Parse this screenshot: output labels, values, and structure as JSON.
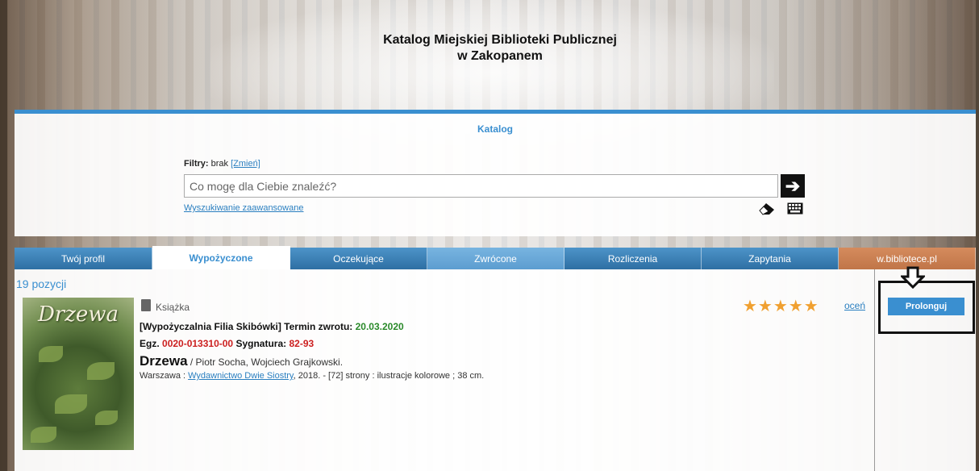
{
  "header": {
    "title_line1": "Katalog Miejskiej Biblioteki Publicznej",
    "title_line2": "w Zakopanem"
  },
  "search": {
    "panel_label": "Katalog",
    "filters_label": "Filtry:",
    "filters_value": "brak",
    "filters_change": "[Zmień]",
    "placeholder": "Co mogę dla Ciebie znaleźć?",
    "go_symbol": "➔",
    "advanced_link": "Wyszukiwanie zaawansowane",
    "icons": [
      "eraser-icon",
      "keyboard-icon"
    ]
  },
  "tabs": [
    {
      "label": "Twój profil",
      "active": false
    },
    {
      "label": "Wypożyczone",
      "active": true
    },
    {
      "label": "Oczekujące",
      "active": false
    },
    {
      "label": "Zwrócone",
      "active": false
    },
    {
      "label": "Rozliczenia",
      "active": false
    },
    {
      "label": "Zapytania",
      "active": false
    },
    {
      "label": "w.bibliotece.pl",
      "active": false
    }
  ],
  "results": {
    "count_text": "19 pozycji",
    "item": {
      "cover_title": "Drzewa",
      "type": "Książka",
      "location": "[Wypożyczalnia Filia Skibówki]",
      "due_label": "Termin zwrotu:",
      "due_date": "20.03.2020",
      "copy_label": "Egz.",
      "copy_id": "0020-013310-00",
      "signature_label": "Sygnatura:",
      "signature": "82-93",
      "title": "Drzewa",
      "authors": " / Piotr Socha, Wojciech Grajkowski.",
      "place": "Warszawa : ",
      "publisher": "Wydawnictwo Dwie Siostry",
      "details": ", 2018. - [72] strony : ilustracje kolorowe ; 38 cm.",
      "stars": "★★★★★",
      "rate_link": "oceń",
      "prolong_button": "Prolonguj"
    }
  },
  "colors": {
    "accent": "#3a8fd0",
    "due_date": "#2a8a2a",
    "ids": "#cc1f1f",
    "stars": "#f0a030"
  }
}
